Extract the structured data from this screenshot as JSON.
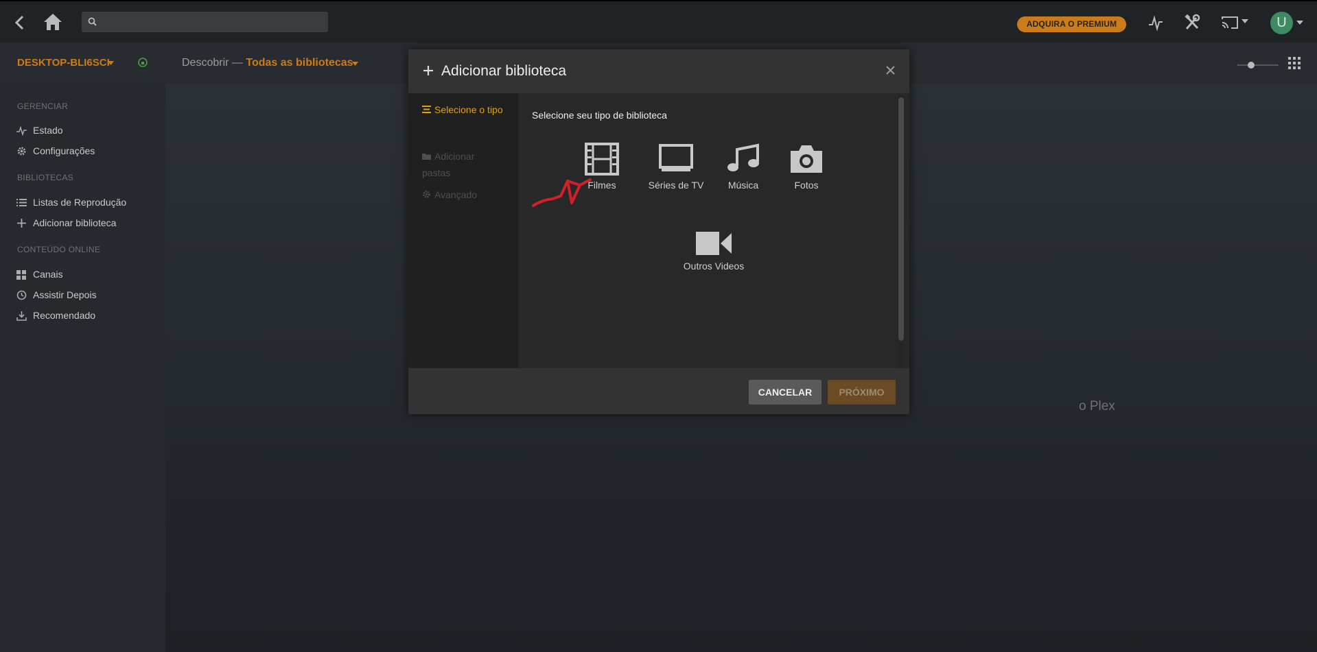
{
  "topbar": {
    "search_placeholder": "",
    "premium_label": "ADQUIRA O PREMIUM",
    "avatar_initial": "U",
    "icons": [
      "back-arrow-icon",
      "home-icon",
      "search-icon",
      "activity-icon",
      "settings-tools-icon",
      "cast-icon",
      "chevron-down-icon"
    ]
  },
  "subbar": {
    "server_name": "DESKTOP-BLI6SCI",
    "breadcrumb_section": "Descobrir",
    "breadcrumb_separator": "—",
    "breadcrumb_library": "Todas as bibliotecas"
  },
  "sidebar": {
    "sections": [
      {
        "heading": "GERENCIAR",
        "items": [
          {
            "label": "Estado",
            "icon": "activity-icon"
          },
          {
            "label": "Configurações",
            "icon": "gear-icon"
          }
        ]
      },
      {
        "heading": "BIBLIOTECAS",
        "items": [
          {
            "label": "Listas de Reprodução",
            "icon": "list-icon"
          },
          {
            "label": "Adicionar biblioteca",
            "icon": "plus-icon"
          }
        ]
      },
      {
        "heading": "CONTEÚDO ONLINE",
        "items": [
          {
            "label": "Canais",
            "icon": "grid-icon"
          },
          {
            "label": "Assistir Depois",
            "icon": "clock-icon"
          },
          {
            "label": "Recomendado",
            "icon": "download-icon"
          }
        ]
      }
    ]
  },
  "main": {
    "background_text": "o Plex"
  },
  "modal": {
    "title": "Adicionar biblioteca",
    "steps": [
      {
        "label": "Selecione o tipo",
        "state": "active"
      },
      {
        "label": "Adicionar pastas",
        "state": "inactive"
      },
      {
        "label": "Avançado",
        "state": "inactive"
      }
    ],
    "content_title": "Selecione seu tipo de biblioteca",
    "library_types": [
      {
        "label": "Filmes",
        "icon": "film-icon"
      },
      {
        "label": "Séries de TV",
        "icon": "tv-icon"
      },
      {
        "label": "Música",
        "icon": "music-icon"
      },
      {
        "label": "Fotos",
        "icon": "camera-icon"
      },
      {
        "label": "Outros Videos",
        "icon": "video-camera-icon"
      }
    ],
    "cancel_label": "CANCELAR",
    "next_label": "PRÓXIMO"
  },
  "colors": {
    "accent": "#e5a00d",
    "brand_orange": "#cc7b19",
    "annotation_red": "#d0202a"
  }
}
